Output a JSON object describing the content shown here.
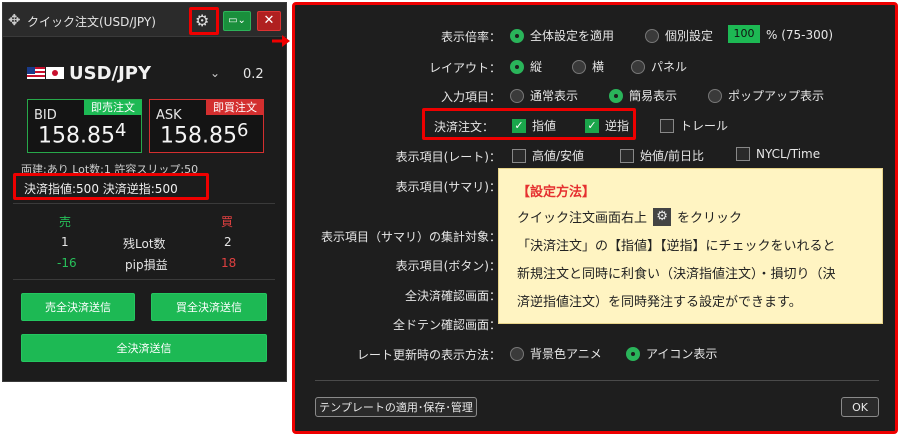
{
  "quick_order": {
    "title": "クイック注文(USD/JPY)",
    "pair": "USD/JPY",
    "lot": "0.2",
    "bid": {
      "label": "BID",
      "tag": "即売注文",
      "price_main": "158.85",
      "price_sup": "4"
    },
    "ask": {
      "label": "ASK",
      "tag": "即買注文",
      "price_main": "158.85",
      "price_sup": "6"
    },
    "info_line": "両建:あり Lot数:1 許容スリップ:50",
    "settle_info": "決済指値:500 決済逆指:500",
    "table": {
      "sell_label": "売",
      "buy_label": "買",
      "rows": [
        {
          "left": "1",
          "label": "残Lot数",
          "right": "2"
        },
        {
          "left": "-16",
          "label": "pip損益",
          "right": "18"
        }
      ]
    },
    "buttons": {
      "sell_all": "売全決済送信",
      "buy_all": "買全決済送信",
      "all": "全決済送信"
    }
  },
  "settings": {
    "display_ratio": {
      "label": "表示倍率：",
      "opt1": "全体設定を適用",
      "opt2": "個別設定",
      "value": "100",
      "range": "% (75-300)"
    },
    "layout": {
      "label": "レイアウト：",
      "opts": [
        "縦",
        "横",
        "パネル"
      ]
    },
    "input": {
      "label": "入力項目：",
      "opts": [
        "通常表示",
        "簡易表示",
        "ポップアップ表示"
      ]
    },
    "settle": {
      "label": "決済注文：",
      "opts": [
        "指値",
        "逆指",
        "トレール"
      ]
    },
    "rate": {
      "label": "表示項目(レート)：",
      "opts": [
        "高値/安値",
        "始値/前日比",
        "NYCL/Time"
      ]
    },
    "summary_label": "表示項目(サマリ)：",
    "summary_target_label": "表示項目（サマリ）の集計対象：",
    "button_label": "表示項目(ボタン)：",
    "confirm_all_label": "全決済確認画面：",
    "confirm_doten_label": "全ドテン確認画面：",
    "refresh": {
      "label": "レート更新時の表示方法：",
      "opts": [
        "背景色アニメ",
        "アイコン表示"
      ]
    },
    "template_button": "テンプレートの適用･保存･管理",
    "ok_button": "OK"
  },
  "note": {
    "heading": "【設定方法】",
    "line1a": "クイック注文画面右上",
    "line1b": "をクリック",
    "line2": "「決済注文」の【指値】【逆指】にチェックをいれると",
    "line3": "新規注文と同時に利食い（決済指値注文）・損切り（決",
    "line4": "済逆指値注文）を同時発注する設定ができます。"
  },
  "colors": {
    "accent_green": "#1db954",
    "highlight_red": "#e00000",
    "bid_green": "#27a84a",
    "ask_red": "#d32f2f",
    "note_bg": "#fff4c2"
  }
}
